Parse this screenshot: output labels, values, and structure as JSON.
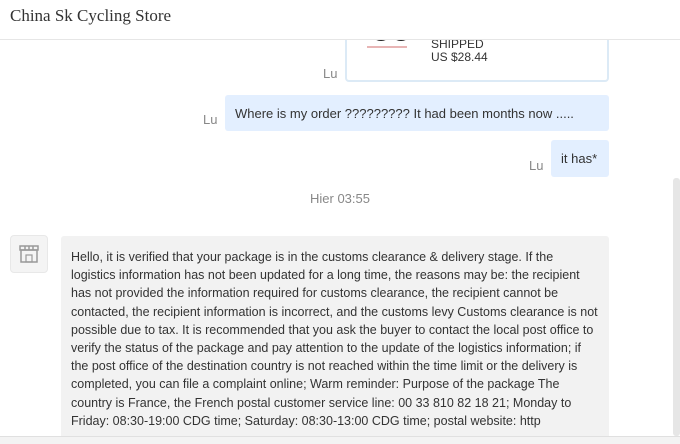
{
  "header": {
    "title": "China Sk Cycling Store"
  },
  "messages": {
    "order_card": {
      "status": "SHIPPED",
      "price": "US $28.44"
    },
    "sender_lu_1": "Lu",
    "sender_lu_2": "Lu",
    "sender_lu_3": "Lu",
    "msg_where_order": "Where is my order ????????? It had been months now .....",
    "msg_it_has": "it has*",
    "timestamp": "Hier 03:55",
    "seller_reply": "Hello, it is verified that your package is in the customs clearance & delivery stage. If the logistics information has not been updated for a long time, the reasons may be: the recipient has not provided the information required for customs clearance, the recipient cannot be contacted, the recipient information is incorrect, and the customs levy Customs clearance is not possible due to tax. It is recommended that you ask the buyer to contact the local post office to verify the status of the package and pay attention to the update of the logistics information; if the post office of the destination country is not reached within the time limit or the delivery is completed, you can file a complaint online; Warm reminder: Purpose of the package The country is France, the French postal customer service line: 00 33 810 82 18 21; Monday to Friday: 08:30-19:00 CDG time; Saturday: 08:30-13:00 CDG time; postal website: http"
  },
  "icons": {
    "seller_avatar": "store-icon"
  }
}
